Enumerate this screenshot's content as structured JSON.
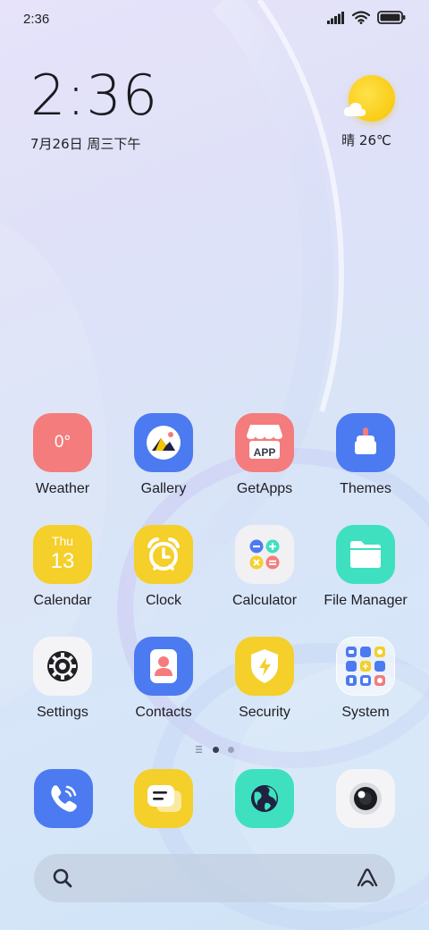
{
  "status_bar": {
    "time": "2:36"
  },
  "clock_widget": {
    "time": "2:36",
    "date": "7月26日 周三下午"
  },
  "weather_widget": {
    "text": "晴 26℃"
  },
  "apps": {
    "weather": {
      "label": "Weather",
      "icon_text": "0°"
    },
    "gallery": {
      "label": "Gallery"
    },
    "getapps": {
      "label": "GetApps",
      "icon_text": "APP"
    },
    "themes": {
      "label": "Themes"
    },
    "calendar": {
      "label": "Calendar",
      "day": "Thu",
      "date": "13"
    },
    "clock": {
      "label": "Clock"
    },
    "calculator": {
      "label": "Calculator"
    },
    "file_manager": {
      "label": "File Manager"
    },
    "settings": {
      "label": "Settings"
    },
    "contacts": {
      "label": "Contacts"
    },
    "security": {
      "label": "Security"
    },
    "system": {
      "label": "System"
    }
  },
  "page_indicator": {
    "pages": 2,
    "current": 1
  },
  "dock": [
    "phone",
    "messages",
    "browser",
    "camera"
  ],
  "colors": {
    "weather": "#f47c7c",
    "gallery": "#4c7af0",
    "getapps": "#f47c7c",
    "themes": "#4c7af0",
    "calendar": "#f5cf2a",
    "clock": "#f5cf2a",
    "calculator": "#f1f1f3",
    "file_manager": "#3ee0c0",
    "settings": "#f4f4f6",
    "contacts": "#4c7af0",
    "security": "#f5cf2a",
    "sun": "#f7c400"
  }
}
